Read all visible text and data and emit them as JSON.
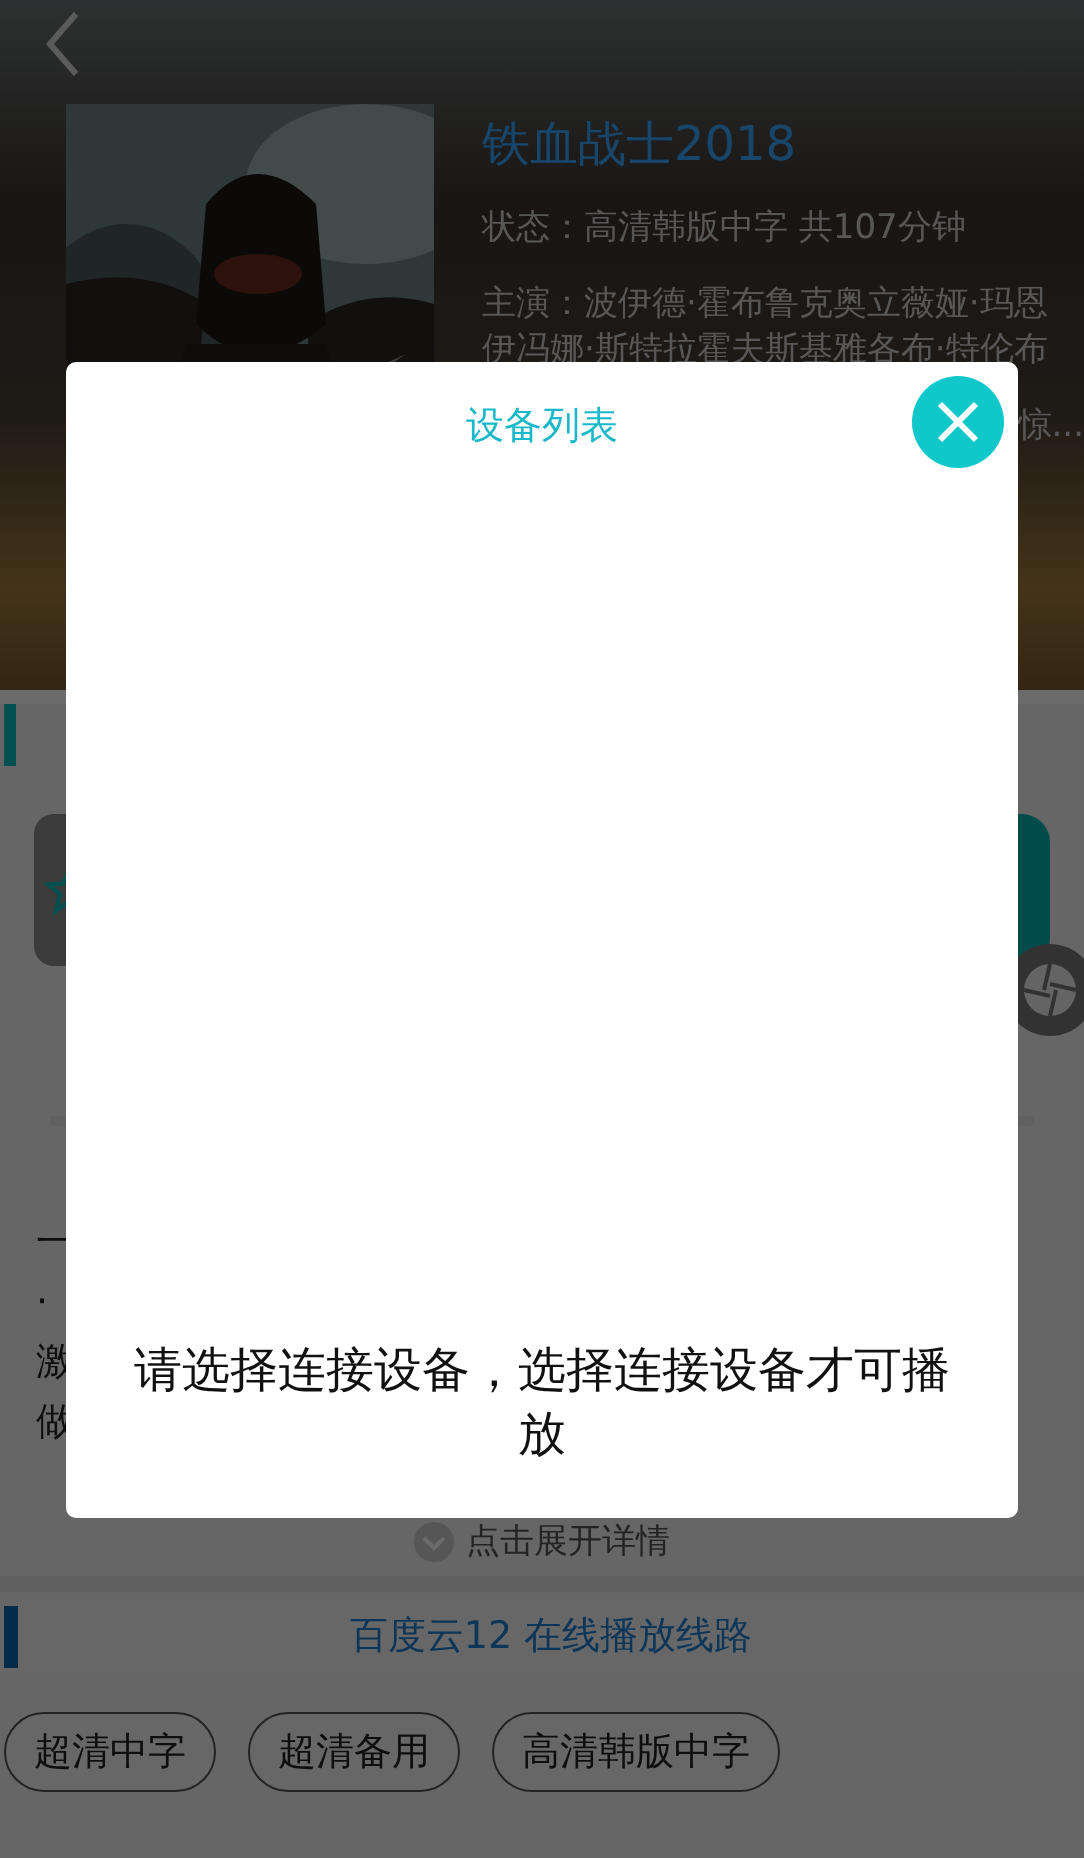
{
  "movie": {
    "title": "铁血战士2018",
    "status": "状态：高清韩版中字 共107分钟",
    "cast_lines": [
      "主演：波伊德·霍布鲁克奥立薇娅·玛恩",
      "伊冯娜·斯特拉霍夫斯基雅各布·特伦布"
    ],
    "summary_fragment": "惊..."
  },
  "description_fragments": [
    "一",
    "·",
    "激",
    "做"
  ],
  "expand_link": "点击展开详情",
  "source": {
    "title": "百度云12 在线播放线路",
    "lines": [
      "超清中字",
      "超清备用",
      "高清韩版中字"
    ]
  },
  "dialog": {
    "title": "设备列表",
    "message": "请选择连接设备，选择连接设备才可播放"
  }
}
